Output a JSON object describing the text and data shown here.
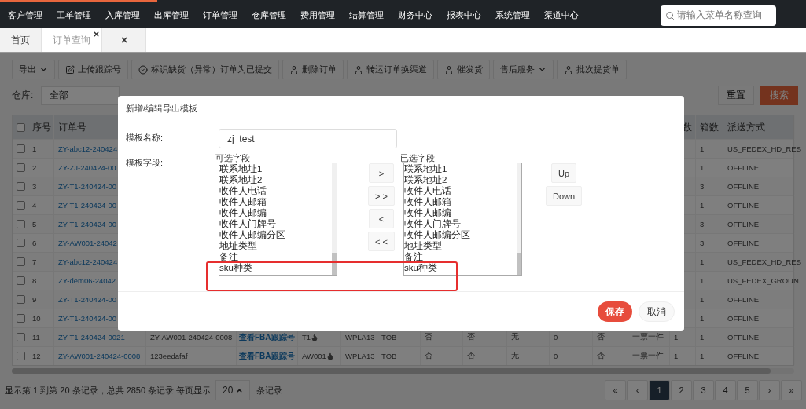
{
  "nav": {
    "items": [
      "客户管理",
      "工单管理",
      "入库管理",
      "出库管理",
      "订单管理",
      "仓库管理",
      "费用管理",
      "结算管理",
      "财务中心",
      "报表中心",
      "系统管理",
      "渠道中心"
    ],
    "search": {
      "placeholder": "请输入菜单名称查询"
    }
  },
  "tabs": [
    {
      "label": "首页",
      "selected": false,
      "closable": false
    },
    {
      "label": "订单查询",
      "selected": true,
      "closable": true
    }
  ],
  "toolbar": [
    {
      "label": "导出",
      "kind": "dropdown"
    },
    {
      "label": "上传跟踪号",
      "kind": "edit"
    },
    {
      "label": "标识缺货（异常）订单为已提交",
      "kind": "check"
    },
    {
      "label": "删除订单",
      "kind": "user"
    },
    {
      "label": "转运订单换渠道",
      "kind": "user"
    },
    {
      "label": "催发货",
      "kind": "user"
    },
    {
      "label": "售后服务",
      "kind": "dropdown"
    },
    {
      "label": "批次提货单",
      "kind": "user"
    }
  ],
  "filters": {
    "warehouse_label": "仓库:",
    "warehouse_value": "全部",
    "reset": "重置",
    "search": "搜索"
  },
  "table": {
    "header": {
      "checked": false,
      "seq": "序号",
      "order_no": "订单号",
      "column_14": "数",
      "boxes": "箱数",
      "delivery": "派送方式"
    },
    "rows": [
      {
        "checked": false,
        "seq": "1",
        "order_no": "ZY-abc12-240424",
        "boxes": "1",
        "delivery": "US_FEDEX_HD_RES"
      },
      {
        "checked": false,
        "seq": "2",
        "order_no": "ZY-ZJ-240424-00",
        "boxes": "1",
        "delivery": "OFFLINE"
      },
      {
        "checked": false,
        "seq": "3",
        "order_no": "ZY-T1-240424-00",
        "boxes": "3",
        "delivery": "OFFLINE"
      },
      {
        "checked": false,
        "seq": "4",
        "order_no": "ZY-T1-240424-00",
        "boxes": "1",
        "delivery": "OFFLINE"
      },
      {
        "checked": false,
        "seq": "5",
        "order_no": "ZY-T1-240424-00",
        "boxes": "3",
        "delivery": "OFFLINE"
      },
      {
        "checked": false,
        "seq": "6",
        "order_no": "ZY-AW001-24042",
        "boxes": "3",
        "delivery": "OFFLINE"
      },
      {
        "checked": false,
        "seq": "7",
        "order_no": "ZY-abc12-240424",
        "boxes": "1",
        "delivery": "US_FEDEX_HD_RES"
      },
      {
        "checked": false,
        "seq": "8",
        "order_no": "ZY-dem06-24042",
        "boxes": "1",
        "delivery": "US_FEDEX_GROUN"
      },
      {
        "checked": false,
        "seq": "9",
        "order_no": "ZY-T1-240424-00",
        "boxes": "1",
        "delivery": "OFFLINE"
      },
      {
        "checked": false,
        "seq": "10",
        "order_no": "ZY-T1-240424-00",
        "boxes": "1",
        "delivery": "OFFLINE"
      },
      {
        "checked": false,
        "seq": "11",
        "order_no": "ZY-T1-240424-0021",
        "ref_no": "ZY-AW001-240424-0008",
        "fba": "查看FBA跟踪号",
        "column_5": "T1",
        "column_6": "WPLA13",
        "column_7": "TOB",
        "column_8": "否",
        "column_9": "否",
        "column_10": "无",
        "column_11": "0",
        "column_12": "否",
        "column_13": "一票一件",
        "column_14": "1",
        "boxes": "1",
        "delivery": "OFFLINE"
      },
      {
        "checked": false,
        "seq": "12",
        "order_no": "ZY-AW001-240424-0008",
        "ref_no": "123eedafaf",
        "fba": "查看FBA跟踪号",
        "column_5": "AW001",
        "column_6": "WPLA13",
        "column_7": "TOB",
        "column_8": "否",
        "column_9": "否",
        "column_10": "无",
        "column_11": "0",
        "column_12": "否",
        "column_13": "一票一件",
        "column_14": "1",
        "boxes": "1",
        "delivery": "OFFLINE"
      }
    ]
  },
  "footer": {
    "summary": "显示第 1 到第 20 条记录，总共 2850 条记录 每页显示",
    "page_size": "20",
    "suffix": "条记录",
    "pages": [
      {
        "label": "«",
        "selected": false
      },
      {
        "label": "‹",
        "selected": false
      },
      {
        "label": "1",
        "selected": true
      },
      {
        "label": "2",
        "selected": false
      },
      {
        "label": "3",
        "selected": false
      },
      {
        "label": "4",
        "selected": false
      },
      {
        "label": "5",
        "selected": false
      },
      {
        "label": "›",
        "selected": false
      },
      {
        "label": "»",
        "selected": false
      }
    ]
  },
  "modal": {
    "title": "新增/编辑导出模板",
    "name_label": "模板名称:",
    "name_value": "zj_test",
    "fields_label": "模板字段:",
    "available_caption": "可选字段",
    "available": [
      "联系地址1",
      "联系地址2",
      "收件人电话",
      "收件人邮箱",
      "收件人邮编",
      "收件人门牌号",
      "收件人邮编分区",
      "地址类型",
      "备注",
      "sku种类"
    ],
    "transfer_buttons": [
      ">",
      "> >",
      "<",
      "< <"
    ],
    "selected_caption": "已选字段",
    "selected": [
      "联系地址1",
      "联系地址2",
      "收件人电话",
      "收件人邮箱",
      "收件人邮编",
      "收件人门牌号",
      "收件人邮编分区",
      "地址类型",
      "备注",
      "sku种类"
    ],
    "order_buttons": [
      "Up",
      "Down"
    ],
    "save": "保存",
    "cancel": "取消"
  }
}
